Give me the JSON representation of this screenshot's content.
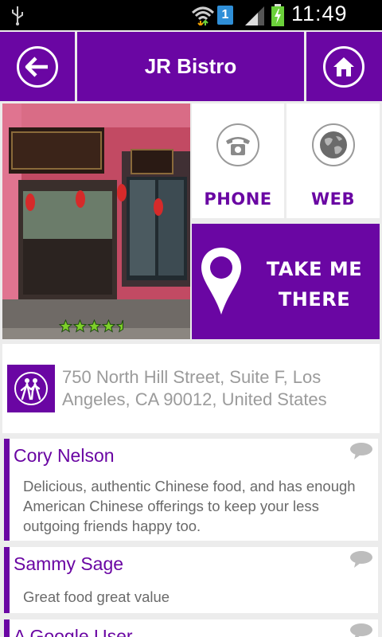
{
  "status_bar": {
    "time": "11:49 AM",
    "sim_label": "1",
    "icons": [
      "usb-icon",
      "wifi-icon",
      "sim-icon",
      "signal-icon",
      "battery-charging-icon"
    ]
  },
  "header": {
    "title": "JR Bistro",
    "back_icon": "arrow-left-icon",
    "home_icon": "home-icon"
  },
  "photo": {
    "rating": 4.5,
    "rating_max": 5
  },
  "actions": {
    "phone_label": "PHONE",
    "web_label": "WEB",
    "navigate_label": "TAKE ME THERE"
  },
  "address": {
    "text": "750 North Hill Street, Suite F, Los Angeles, CA 90012, United States",
    "icon": "walking-icon"
  },
  "reviews": [
    {
      "author": "Cory Nelson",
      "text": "Delicious, authentic Chinese food, and has enough American Chinese offerings to keep your less outgoing friends happy too."
    },
    {
      "author": "Sammy Sage",
      "text": "Great food great value"
    },
    {
      "author": "A Google User",
      "text": ""
    }
  ],
  "colors": {
    "accent": "#6a06a3",
    "background": "#ececec",
    "muted_text": "#9b9b9b",
    "star": "#7ecf2a"
  }
}
